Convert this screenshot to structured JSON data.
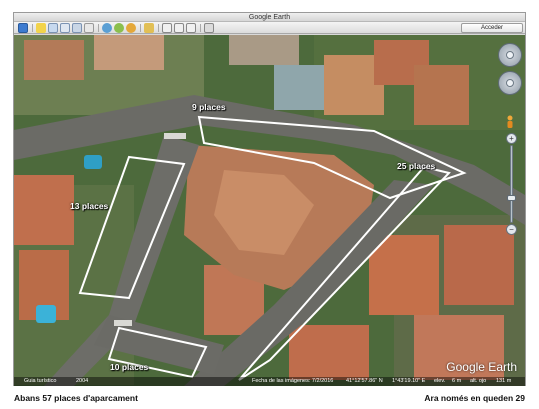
{
  "window": {
    "title": "Google Earth",
    "sign_in_label": "Acceder"
  },
  "toolbar": {
    "buttons": [
      "sidebar-toggle-icon",
      "placemark-icon",
      "polygon-icon",
      "path-icon",
      "image-overlay-icon",
      "tour-icon",
      "historical-imagery-icon",
      "sun-icon",
      "planets-icon",
      "ruler-icon",
      "email-icon",
      "print-icon",
      "save-image-icon",
      "maps-icon"
    ]
  },
  "map": {
    "labels": {
      "zone_a": "9 places",
      "zone_b": "25 places",
      "zone_c": "13 places",
      "zone_d": "10 places"
    },
    "overlay_color": "#ffffff",
    "logo": "Google Earth"
  },
  "statusbar": {
    "tour_label": "Guia turístico",
    "year": "2004",
    "imagery_date": "Fecha de las imágenes: 7/2/2016",
    "lat": "41°12'57.86\" N",
    "lon": "1°43'19.10\" E",
    "elev_label": "elev.",
    "elev_value": "6 m",
    "eye_label": "alt. ojo",
    "eye_value": "131 m"
  },
  "caption": {
    "left": "Abans 57 places d'aparcament",
    "right": "Ara només en queden  29"
  }
}
